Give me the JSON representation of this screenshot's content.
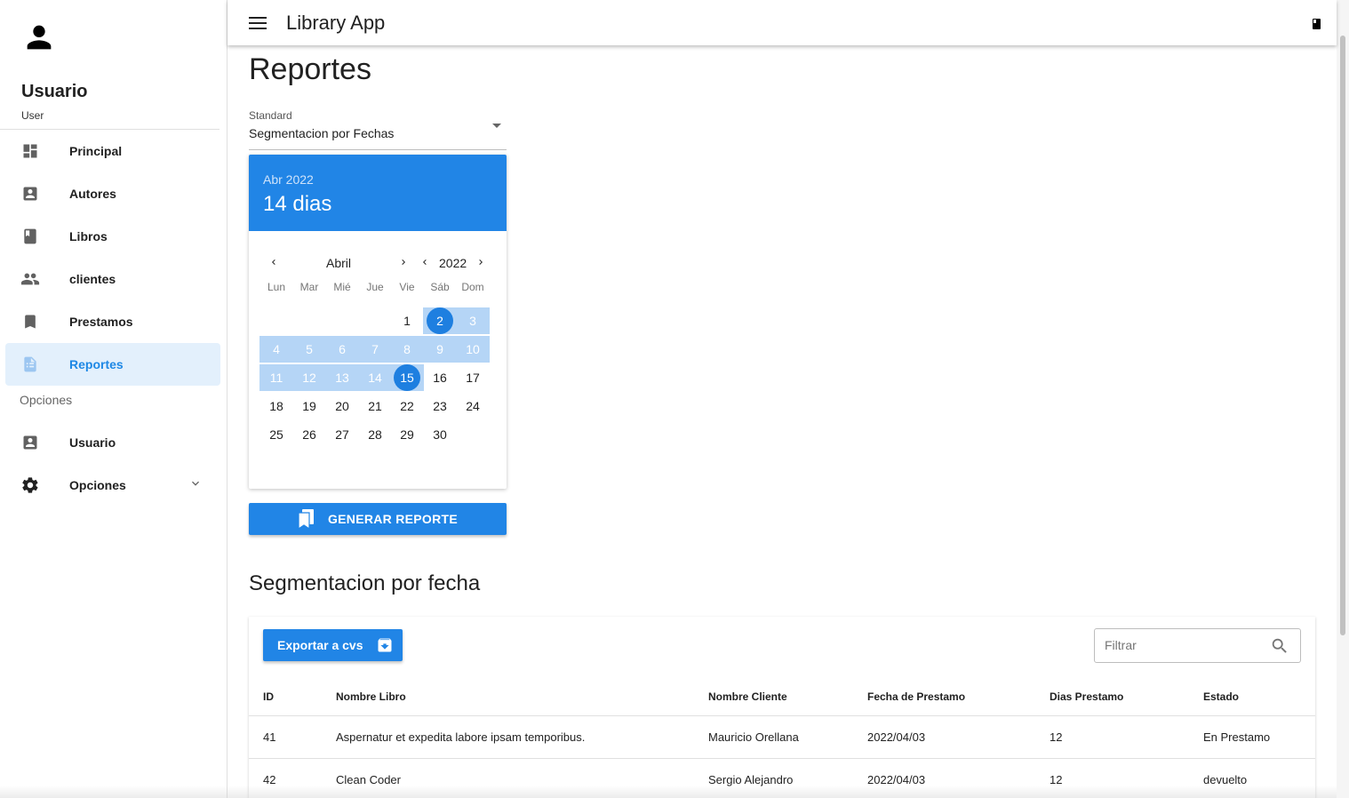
{
  "sidebar": {
    "user_name": "Usuario",
    "user_role": "User",
    "items": [
      {
        "label": "Principal",
        "icon": "dashboard-icon"
      },
      {
        "label": "Autores",
        "icon": "contact-card-icon"
      },
      {
        "label": "Libros",
        "icon": "book-icon"
      },
      {
        "label": "clientes",
        "icon": "people-icon"
      },
      {
        "label": "Prestamos",
        "icon": "bookmark-icon"
      },
      {
        "label": "Reportes",
        "icon": "report-icon",
        "active": true
      }
    ],
    "options_header": "Opciones",
    "options_items": [
      {
        "label": "Usuario",
        "icon": "contact-card-icon"
      },
      {
        "label": "Opciones",
        "icon": "gear-icon"
      }
    ]
  },
  "topbar": {
    "title": "Library App"
  },
  "main": {
    "page_title": "Reportes",
    "select": {
      "label": "Standard",
      "value": "Segmentacion por Fechas"
    },
    "datepicker": {
      "header_month_year": "Abr 2022",
      "header_range": "14 dias",
      "month": "Abril",
      "year": "2022",
      "weekdays": [
        "Lun",
        "Mar",
        "Mié",
        "Jue",
        "Vie",
        "Sáb",
        "Dom"
      ],
      "days": [
        "1",
        "2",
        "3",
        "4",
        "5",
        "6",
        "7",
        "8",
        "9",
        "10",
        "11",
        "12",
        "13",
        "14",
        "15",
        "16",
        "17",
        "18",
        "19",
        "20",
        "21",
        "22",
        "23",
        "24",
        "25",
        "26",
        "27",
        "28",
        "29",
        "30"
      ],
      "range_start": 2,
      "range_end": 15
    },
    "generate_button": "GENERAR REPORTE",
    "section_title": "Segmentacion por fecha",
    "export_button": "Exportar a cvs",
    "filter_placeholder": "Filtrar",
    "table": {
      "headers": [
        "ID",
        "Nombre Libro",
        "Nombre Cliente",
        "Fecha de Prestamo",
        "Dias Prestamo",
        "Estado"
      ],
      "rows": [
        [
          "41",
          "Aspernatur et expedita labore ipsam temporibus.",
          "Mauricio Orellana",
          "2022/04/03",
          "12",
          "En Prestamo"
        ],
        [
          "42",
          "Clean Coder",
          "Sergio Alejandro",
          "2022/04/03",
          "12",
          "devuelto"
        ]
      ]
    }
  },
  "colors": {
    "accent": "#2185e6",
    "range": "#b5d5f6",
    "active_bg": "#e3f0fc"
  }
}
